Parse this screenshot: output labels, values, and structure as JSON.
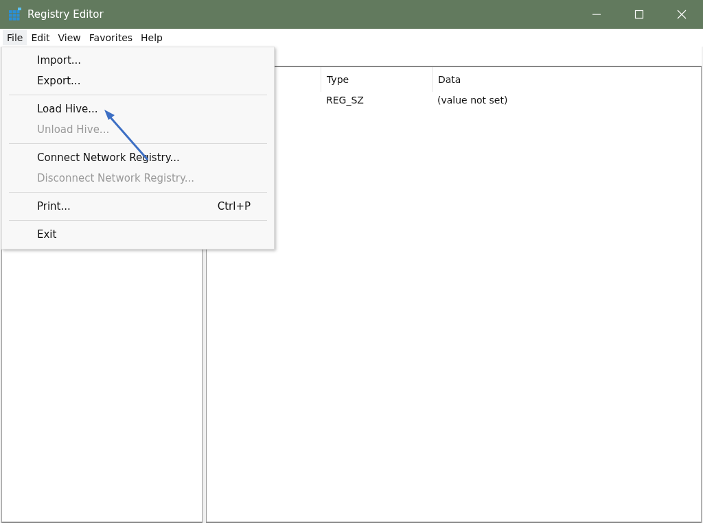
{
  "window": {
    "title": "Registry Editor"
  },
  "menu_bar": [
    {
      "label": "File",
      "selected": true
    },
    {
      "label": "Edit",
      "selected": false
    },
    {
      "label": "View",
      "selected": false
    },
    {
      "label": "Favorites",
      "selected": false
    },
    {
      "label": "Help",
      "selected": false
    }
  ],
  "file_menu": [
    {
      "kind": "item",
      "label": "Import...",
      "disabled": false
    },
    {
      "kind": "item",
      "label": "Export...",
      "disabled": false
    },
    {
      "kind": "separator"
    },
    {
      "kind": "item",
      "label": "Load Hive...",
      "disabled": false
    },
    {
      "kind": "item",
      "label": "Unload Hive...",
      "disabled": true
    },
    {
      "kind": "separator"
    },
    {
      "kind": "item",
      "label": "Connect Network Registry...",
      "disabled": false
    },
    {
      "kind": "item",
      "label": "Disconnect Network Registry...",
      "disabled": true
    },
    {
      "kind": "separator"
    },
    {
      "kind": "item",
      "label": "Print...",
      "disabled": false,
      "shortcut": "Ctrl+P"
    },
    {
      "kind": "separator"
    },
    {
      "kind": "item",
      "label": "Exit",
      "disabled": false
    }
  ],
  "values_list": {
    "columns": [
      "Type",
      "Data"
    ],
    "rows": [
      {
        "type": "REG_SZ",
        "data": "(value not set)"
      }
    ]
  }
}
